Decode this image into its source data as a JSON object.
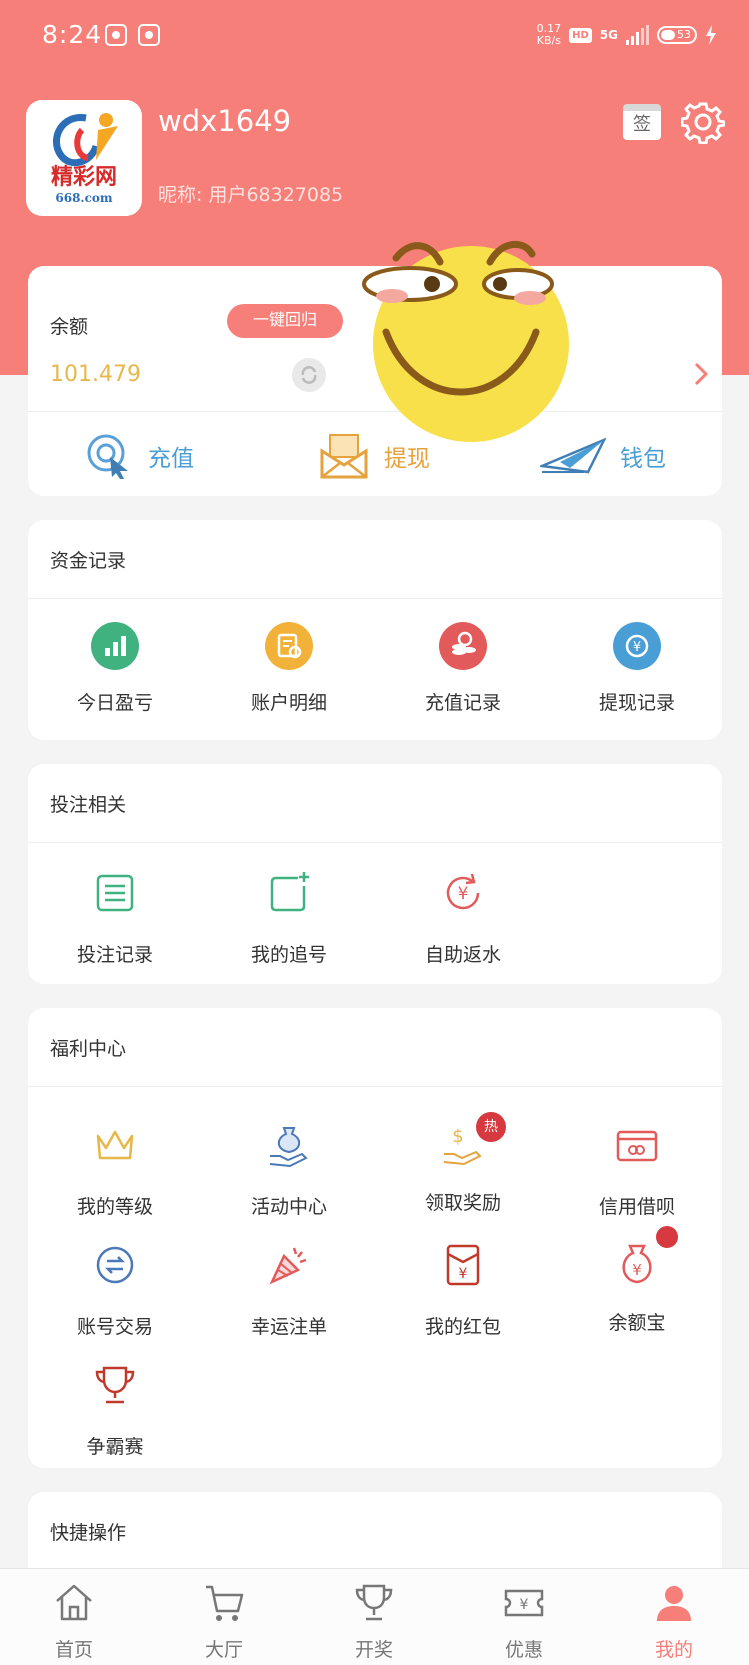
{
  "status": {
    "time": "8:24",
    "speed": "0.17",
    "speed_unit": "KB/s",
    "hd": "HD",
    "network": "5G",
    "battery": "53"
  },
  "profile": {
    "username": "wdx1649",
    "nickname": "昵称: 用户68327085",
    "logo_text": "精彩网",
    "logo_sub": "668.com",
    "sign_label": "签"
  },
  "balance": {
    "label": "余额",
    "recall_label": "一键回归",
    "value": "101.479"
  },
  "quick_actions": [
    {
      "label": "充值"
    },
    {
      "label": "提现"
    },
    {
      "label": "钱包"
    }
  ],
  "funds": {
    "title": "资金记录",
    "items": [
      {
        "label": "今日盈亏",
        "color": "#3fb27f"
      },
      {
        "label": "账户明细",
        "color": "#f2b23a"
      },
      {
        "label": "充值记录",
        "color": "#e35a5a"
      },
      {
        "label": "提现记录",
        "color": "#4a9ed6"
      }
    ]
  },
  "bets": {
    "title": "投注相关",
    "items": [
      {
        "label": "投注记录"
      },
      {
        "label": "我的追号"
      },
      {
        "label": "自助返水"
      }
    ]
  },
  "welfare": {
    "title": "福利中心",
    "hot_badge": "热",
    "items": [
      {
        "label": "我的等级"
      },
      {
        "label": "活动中心"
      },
      {
        "label": "领取奖励"
      },
      {
        "label": "信用借呗"
      },
      {
        "label": "账号交易"
      },
      {
        "label": "幸运注单"
      },
      {
        "label": "我的红包"
      },
      {
        "label": "余额宝"
      },
      {
        "label": "争霸赛"
      }
    ]
  },
  "shortcuts": {
    "title": "快捷操作"
  },
  "tabbar": [
    {
      "label": "首页"
    },
    {
      "label": "大厅"
    },
    {
      "label": "开奖"
    },
    {
      "label": "优惠"
    },
    {
      "label": "我的"
    }
  ],
  "colors": {
    "accent": "#f77f7a",
    "gold": "#e6b84a",
    "blue": "#4a9ed6"
  }
}
